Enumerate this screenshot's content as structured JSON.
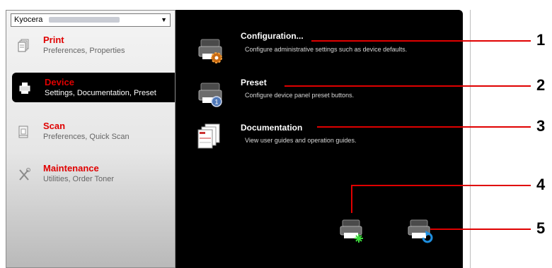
{
  "dropdown": {
    "selected_prefix": "Kyocera"
  },
  "nav": [
    {
      "title": "Print",
      "subtitle": "Preferences, Properties",
      "icon": "document-stack-icon"
    },
    {
      "title": "Device",
      "subtitle": "Settings, Documentation, Preset",
      "icon": "printer-device-icon",
      "active": true
    },
    {
      "title": "Scan",
      "subtitle": "Preferences, Quick Scan",
      "icon": "scanner-icon"
    },
    {
      "title": "Maintenance",
      "subtitle": "Utilities, Order Toner",
      "icon": "tools-icon"
    }
  ],
  "entries": [
    {
      "title": "Configuration...",
      "description": "Configure administrative settings such as device defaults.",
      "icon": "printer-gear-icon"
    },
    {
      "title": "Preset",
      "description": "Configure device panel preset buttons.",
      "icon": "printer-preset-icon"
    },
    {
      "title": "Documentation",
      "description": "View user guides and operation guides.",
      "icon": "documents-icon"
    }
  ],
  "bottom_icons": [
    "printer-status-icon",
    "printer-refresh-icon"
  ],
  "callouts": [
    "1",
    "2",
    "3",
    "4",
    "5"
  ],
  "colors": {
    "accent": "#e00000",
    "panel": "#000000"
  }
}
